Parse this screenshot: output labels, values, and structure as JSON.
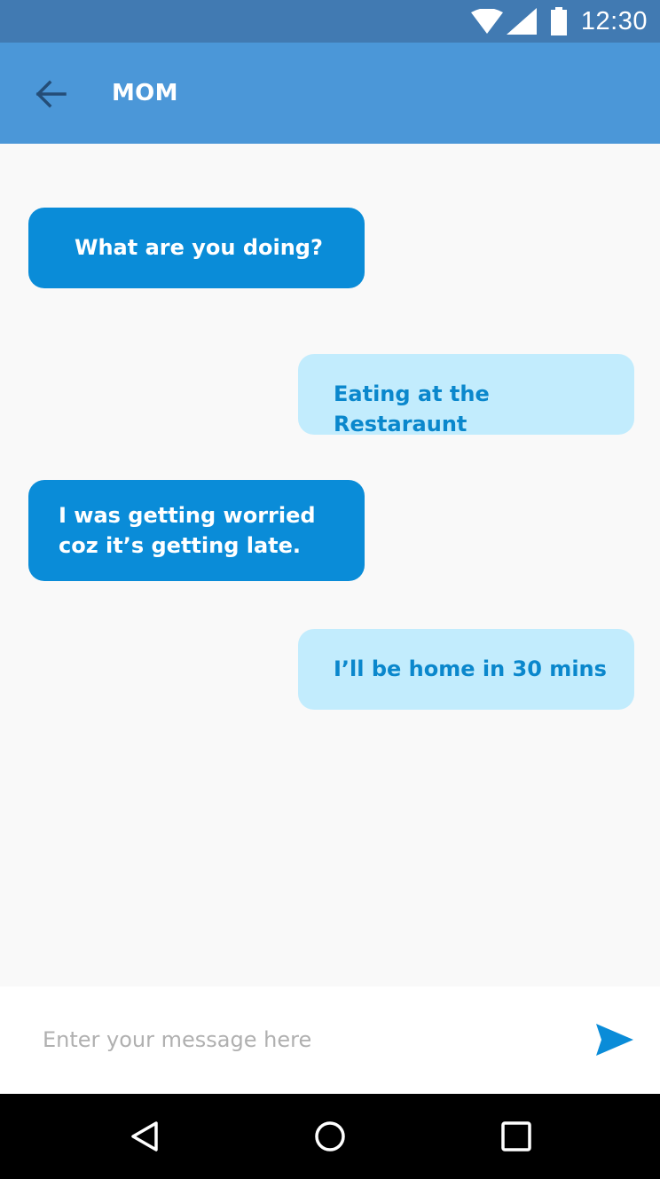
{
  "status_bar": {
    "time": "12:30",
    "icons": [
      "wifi-icon",
      "signal-icon",
      "battery-icon"
    ],
    "color": "#417ab2"
  },
  "app_bar": {
    "title": "MOM",
    "back_icon": "arrow-left-icon",
    "color": "#4b97d8"
  },
  "messages": [
    {
      "direction": "incoming",
      "text": "What are you doing?"
    },
    {
      "direction": "outgoing",
      "text": "Eating at the Restaraunt"
    },
    {
      "direction": "incoming",
      "text": "I was getting worried coz it’s getting late."
    },
    {
      "direction": "outgoing",
      "text": "I’ll be home in 30 mins"
    }
  ],
  "bubble_colors": {
    "incoming_bg": "#0a8cd8",
    "incoming_text": "#ffffff",
    "outgoing_bg": "#c2ecfd",
    "outgoing_text": "#0a87cc"
  },
  "composer": {
    "placeholder": "Enter your message here",
    "value": "",
    "send_icon": "send-icon",
    "send_color": "#0a8cd8"
  },
  "nav_bar": {
    "icons": [
      "nav-back-icon",
      "nav-home-icon",
      "nav-recents-icon"
    ]
  }
}
